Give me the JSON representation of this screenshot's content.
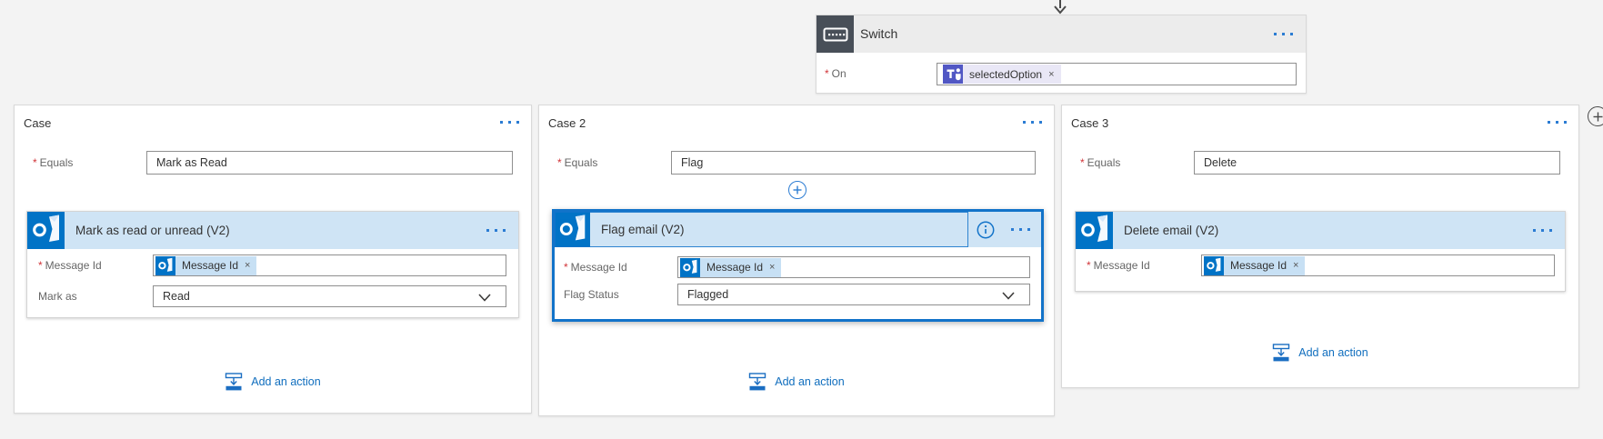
{
  "switch": {
    "title": "Switch",
    "required_marker": "*",
    "on_label": "On",
    "on_token": {
      "text": "selectedOption",
      "remove_glyph": "×"
    }
  },
  "cases": [
    {
      "title": "Case",
      "equals_label": "Equals",
      "equals_value": "Mark as Read",
      "action": {
        "title": "Mark as read or unread (V2)",
        "message_id_label": "Message Id",
        "message_id_token": {
          "text": "Message Id",
          "remove_glyph": "×"
        },
        "second_field_label": "Mark as",
        "second_field_value": "Read"
      },
      "add_action_label": "Add an action"
    },
    {
      "title": "Case 2",
      "equals_label": "Equals",
      "equals_value": "Flag",
      "action": {
        "title": "Flag email (V2)",
        "selected": true,
        "message_id_label": "Message Id",
        "message_id_token": {
          "text": "Message Id",
          "remove_glyph": "×"
        },
        "second_field_label": "Flag Status",
        "second_field_value": "Flagged"
      },
      "add_action_label": "Add an action"
    },
    {
      "title": "Case 3",
      "equals_label": "Equals",
      "equals_value": "Delete",
      "action": {
        "title": "Delete email (V2)",
        "message_id_label": "Message Id",
        "message_id_token": {
          "text": "Message Id",
          "remove_glyph": "×"
        }
      },
      "add_action_label": "Add an action"
    }
  ],
  "colors": {
    "canvas_bg": "#f3f3f3",
    "selection_blue": "#1273c9",
    "outlook_blue": "#0173c6",
    "teams_purple": "#5157c4",
    "action_header_blue": "#cfe4f5",
    "token_blue": "#c7e0f4",
    "token_lavender": "#e9e7f6",
    "link_blue": "#106ebe"
  }
}
